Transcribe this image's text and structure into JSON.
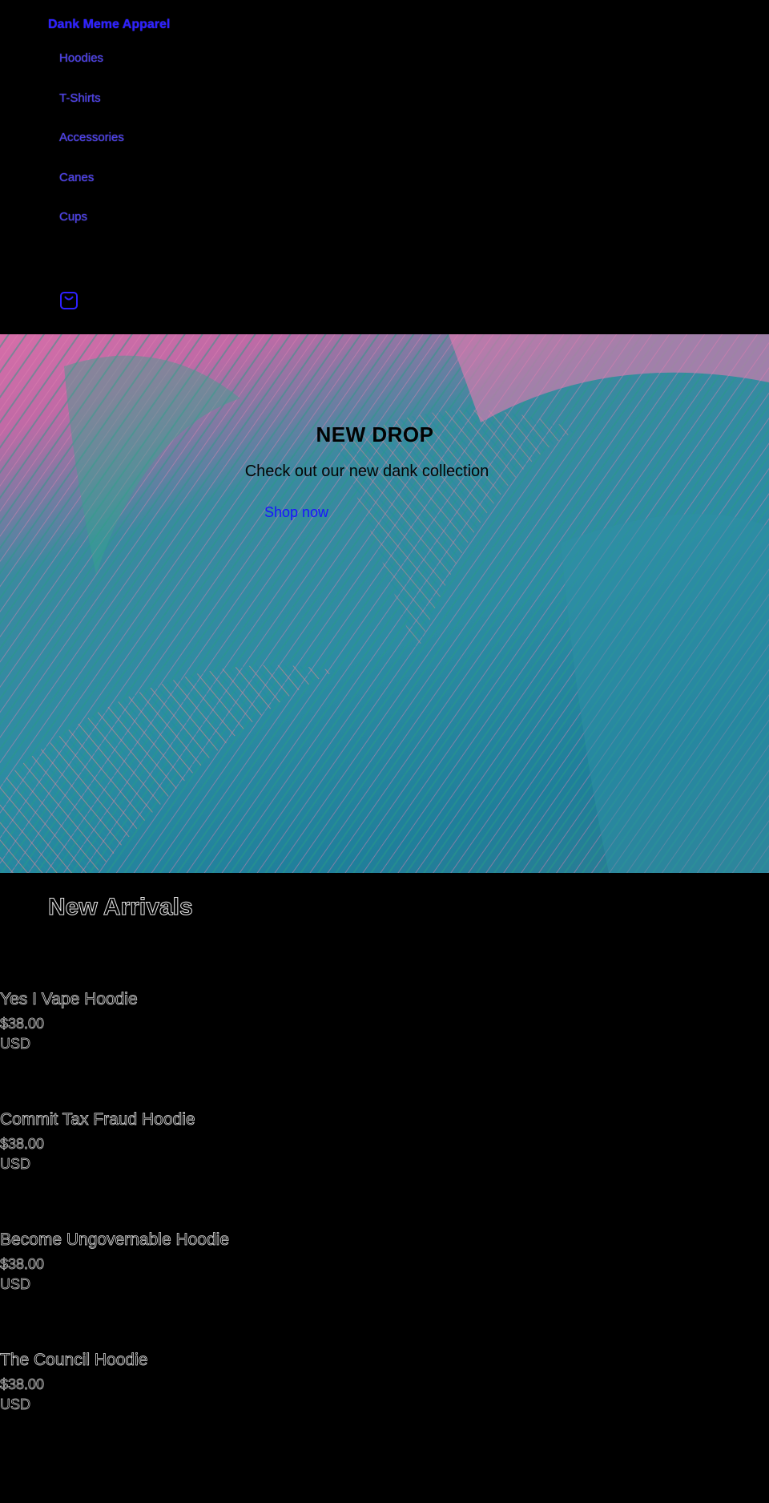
{
  "header": {
    "brand": "Dank Meme Apparel",
    "nav": [
      "Hoodies",
      "T-Shirts",
      "Accessories",
      "Canes",
      "Cups"
    ],
    "cart_icon": "shopping-bag-icon"
  },
  "hero": {
    "title": "NEW DROP",
    "subtitle": "Check out our new dank collection",
    "button": "Shop now"
  },
  "arrivals": {
    "title": "New Arrivals",
    "products": [
      {
        "name": "Yes I Vape Hoodie",
        "price": "$38.00",
        "currency": "USD"
      },
      {
        "name": "Commit Tax Fraud Hoodie",
        "price": "$38.00",
        "currency": "USD"
      },
      {
        "name": "Become Ungovernable Hoodie",
        "price": "$38.00",
        "currency": "USD"
      },
      {
        "name": "The Council Hoodie",
        "price": "$38.00",
        "currency": "USD"
      }
    ]
  },
  "colors": {
    "background": "#000000",
    "link": "#2d20ff",
    "hero_pink": "#d66ea8",
    "hero_teal": "#2c8ca3"
  }
}
